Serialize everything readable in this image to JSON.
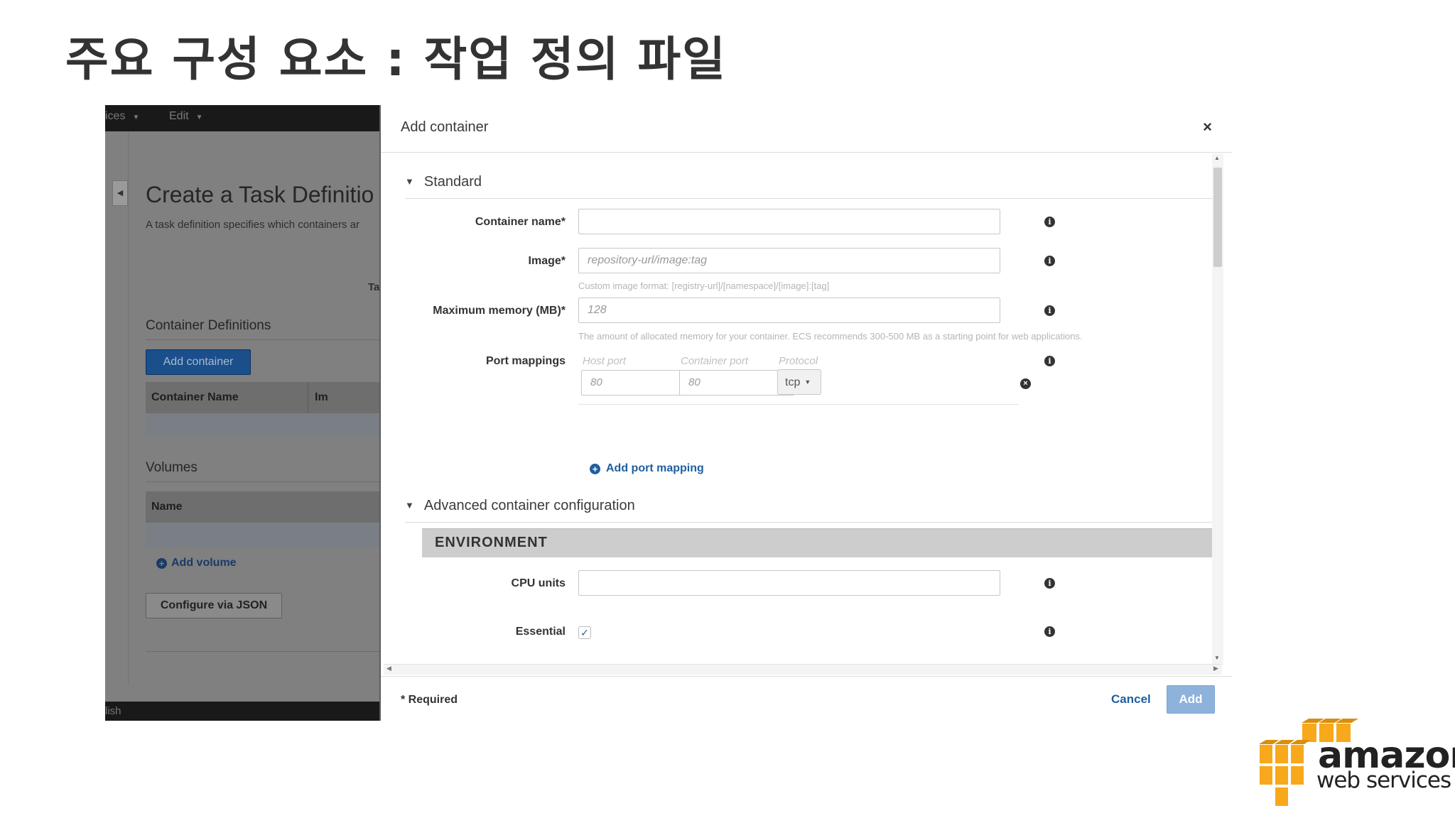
{
  "slide": {
    "title": "주요 구성 요소 : 작업 정의 파일"
  },
  "background_console": {
    "menu_services": "ices",
    "menu_edit": "Edit",
    "page_title": "Create a Task Definitio",
    "description": "A task definition specifies which containers ar",
    "partial_label": "Ta",
    "container_definitions_heading": "Container Definitions",
    "add_container_button": "Add container",
    "container_table": {
      "col_name": "Container Name",
      "col_image": "Im"
    },
    "volumes_heading": "Volumes",
    "volumes_table": {
      "col_name": "Name"
    },
    "add_volume_link": "Add volume",
    "configure_json_button": "Configure via JSON",
    "footer_text": "lish"
  },
  "modal": {
    "title": "Add container",
    "close_icon": "close-icon",
    "standard_section": "Standard",
    "fields": {
      "container_name": {
        "label": "Container name*",
        "value": ""
      },
      "image": {
        "label": "Image*",
        "placeholder": "repository-url/image:tag",
        "help": "Custom image format: [registry-url]/[namespace]/[image]:[tag]"
      },
      "memory": {
        "label": "Maximum memory (MB)*",
        "placeholder": "128",
        "help": "The amount of allocated memory for your container. ECS recommends 300-500 MB as a starting point for web applications."
      },
      "port_mappings": {
        "label": "Port mappings",
        "host_port_label": "Host port",
        "container_port_label": "Container port",
        "protocol_label": "Protocol",
        "host_port_placeholder": "80",
        "container_port_placeholder": "80",
        "protocol_value": "tcp"
      },
      "add_port_mapping_link": "Add port mapping"
    },
    "advanced_section": "Advanced container configuration",
    "environment_heading": "ENVIRONMENT",
    "cpu_units": {
      "label": "CPU units",
      "value": ""
    },
    "essential": {
      "label": "Essential",
      "checked": true
    },
    "footer": {
      "required_note": "* Required",
      "cancel_label": "Cancel",
      "add_label": "Add"
    }
  },
  "logo": {
    "word": "amazon",
    "sub": "web services"
  },
  "colors": {
    "aws_orange": "#f7a81b",
    "link_blue": "#1f5f9e",
    "primary_button_disabled": "#8db2dc"
  }
}
